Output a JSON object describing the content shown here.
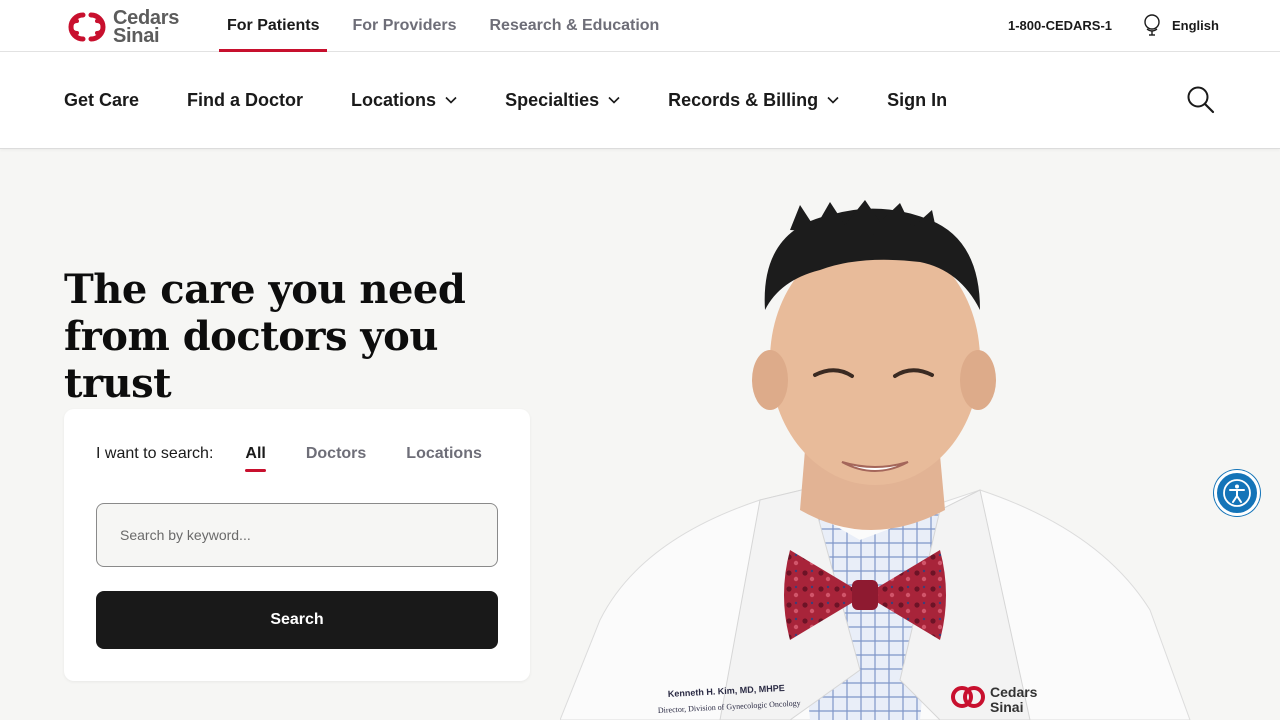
{
  "brand": {
    "line1": "Cedars",
    "line2": "Sinai",
    "accent_color": "#c8102e"
  },
  "audience_tabs": [
    {
      "label": "For Patients",
      "active": true
    },
    {
      "label": "For Providers",
      "active": false
    },
    {
      "label": "Research & Education",
      "active": false
    }
  ],
  "utility": {
    "phone": "1-800-CEDARS-1",
    "language": "English",
    "language_icon": "globe-icon"
  },
  "nav": {
    "items": [
      {
        "label": "Get Care",
        "dropdown": false
      },
      {
        "label": "Find a Doctor",
        "dropdown": false
      },
      {
        "label": "Locations",
        "dropdown": true
      },
      {
        "label": "Specialties",
        "dropdown": true
      },
      {
        "label": "Records & Billing",
        "dropdown": true
      },
      {
        "label": "Sign In",
        "dropdown": false
      }
    ],
    "search_icon": "search-icon"
  },
  "hero": {
    "title": "The care you need from doctors you trust",
    "search": {
      "label": "I want to search:",
      "tabs": [
        {
          "label": "All",
          "active": true
        },
        {
          "label": "Doctors",
          "active": false
        },
        {
          "label": "Locations",
          "active": false
        }
      ],
      "placeholder": "Search by keyword...",
      "value": "",
      "button": "Search"
    },
    "photo": {
      "coat_name": "Kenneth H. Kim, MD, MHPE",
      "coat_title": "Director, Division of Gynecologic Oncology",
      "coat_logo_line1": "Cedars",
      "coat_logo_line2": "Sinai"
    }
  },
  "accessibility": {
    "icon": "accessibility-icon",
    "color": "#1474b8"
  }
}
